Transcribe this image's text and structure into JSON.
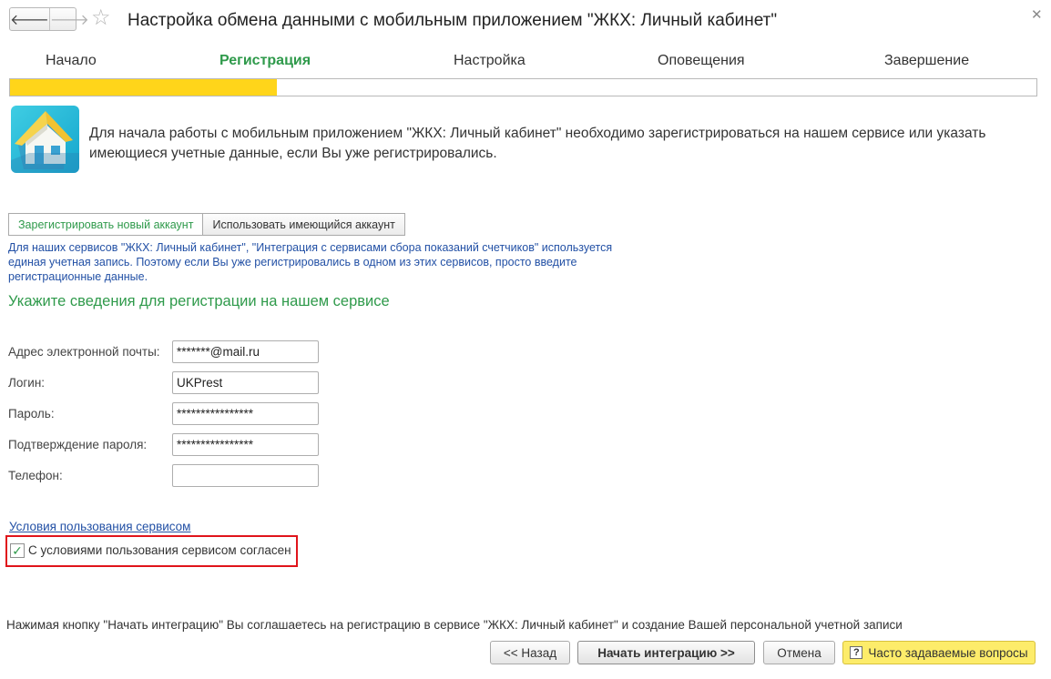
{
  "window": {
    "title": "Настройка обмена данными с мобильным приложением \"ЖКХ: Личный кабинет\"",
    "back_icon": "arrow-left-icon",
    "forward_icon": "arrow-right-icon",
    "favorite_icon": "star-icon",
    "close_icon": "close-icon"
  },
  "steps": [
    {
      "label": "Начало",
      "active": false
    },
    {
      "label": "Регистрация",
      "active": true
    },
    {
      "label": "Настройка",
      "active": false
    },
    {
      "label": "Оповещения",
      "active": false
    },
    {
      "label": "Завершение",
      "active": false
    }
  ],
  "progress": {
    "percent": 26,
    "color": "#ffd51a"
  },
  "intro": {
    "app_icon": "house-app-icon",
    "text": "Для начала работы с мобильным приложением \"ЖКХ: Личный кабинет\" необходимо зарегистрироваться на нашем сервисе или указать имеющиеся учетные данные, если Вы уже регистрировались."
  },
  "account_tabs": [
    {
      "label": "Зарегистрировать новый аккаунт",
      "active": true
    },
    {
      "label": "Использовать имеющийся аккаунт",
      "active": false
    }
  ],
  "info_text": "Для наших сервисов \"ЖКХ: Личный кабинет\", \"Интеграция с сервисами сбора показаний счетчиков\" используется единая учетная запись. Поэтому если Вы уже регистрировались в одном из этих сервисов, просто введите регистрационные данные.",
  "form": {
    "section_title": "Укажите сведения для регистрации на нашем сервисе",
    "fields": [
      {
        "label": "Адрес электронной почты:",
        "value": "*******@mail.ru"
      },
      {
        "label": "Логин:",
        "value": "UKPrest"
      },
      {
        "label": "Пароль:",
        "value": "****************"
      },
      {
        "label": "Подтверждение пароля:",
        "value": "****************"
      },
      {
        "label": "Телефон:",
        "value": ""
      }
    ]
  },
  "terms": {
    "link": "Условия пользования сервисом",
    "checkbox_label": "С условиями пользования сервисом согласен",
    "checked": true,
    "highlight_color": "#e0141b"
  },
  "footer": {
    "note": "Нажимая кнопку \"Начать интеграцию\" Вы соглашаетесь на регистрацию в сервисе \"ЖКХ: Личный кабинет\" и создание Вашей персональной учетной записи",
    "back_button": "<< Назад",
    "start_button": "Начать интеграцию >>",
    "cancel_button": "Отмена",
    "faq_button": "Часто задаваемые вопросы",
    "faq_icon": "question-icon"
  },
  "colors": {
    "accent_green": "#2f9a4b",
    "info_blue": "#2250a5",
    "faq_yellow": "#fdec6a"
  }
}
